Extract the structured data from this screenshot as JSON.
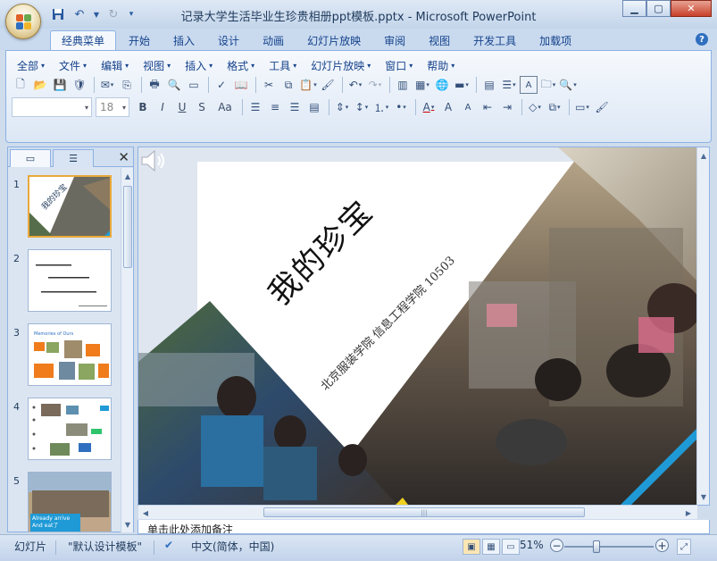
{
  "window": {
    "title": "记录大学生活毕业生珍贵相册ppt模板.pptx - Microsoft PowerPoint"
  },
  "qat": {
    "icons": [
      "save-icon",
      "undo-icon",
      "redo-icon",
      "customize-icon"
    ]
  },
  "tabs": [
    {
      "label": "经典菜单",
      "active": true
    },
    {
      "label": "开始"
    },
    {
      "label": "插入"
    },
    {
      "label": "设计"
    },
    {
      "label": "动画"
    },
    {
      "label": "幻灯片放映"
    },
    {
      "label": "审阅"
    },
    {
      "label": "视图"
    },
    {
      "label": "开发工具"
    },
    {
      "label": "加载项"
    }
  ],
  "menus": [
    "全部",
    "文件",
    "编辑",
    "视图",
    "插入",
    "格式",
    "工具",
    "幻灯片放映",
    "窗口",
    "帮助"
  ],
  "font": {
    "name_value": "",
    "size_value": "18"
  },
  "format_buttons": [
    "B",
    "I",
    "U",
    "S",
    "Aa"
  ],
  "slide": {
    "title": "我的珍宝",
    "subtitle": "北京服装学院 信息工程学院  10503"
  },
  "thumbnails": [
    {
      "num": "1",
      "title": "我的珍宝"
    },
    {
      "num": "2"
    },
    {
      "num": "3",
      "title": "Memories of Ours"
    },
    {
      "num": "4"
    },
    {
      "num": "5",
      "caption": "Already arrive And eat了"
    }
  ],
  "notes": {
    "text": "单击此处添加备注"
  },
  "status": {
    "slide_label": "幻灯片",
    "theme": "\"默认设计模板\"",
    "language": "中文(简体，中国)",
    "zoom": "51%",
    "zoom_fraction": 0.36
  },
  "colors": {
    "accent": "#2f6fbf",
    "selection": "#e9a93a",
    "slide_bar": "#1f9ad6"
  }
}
